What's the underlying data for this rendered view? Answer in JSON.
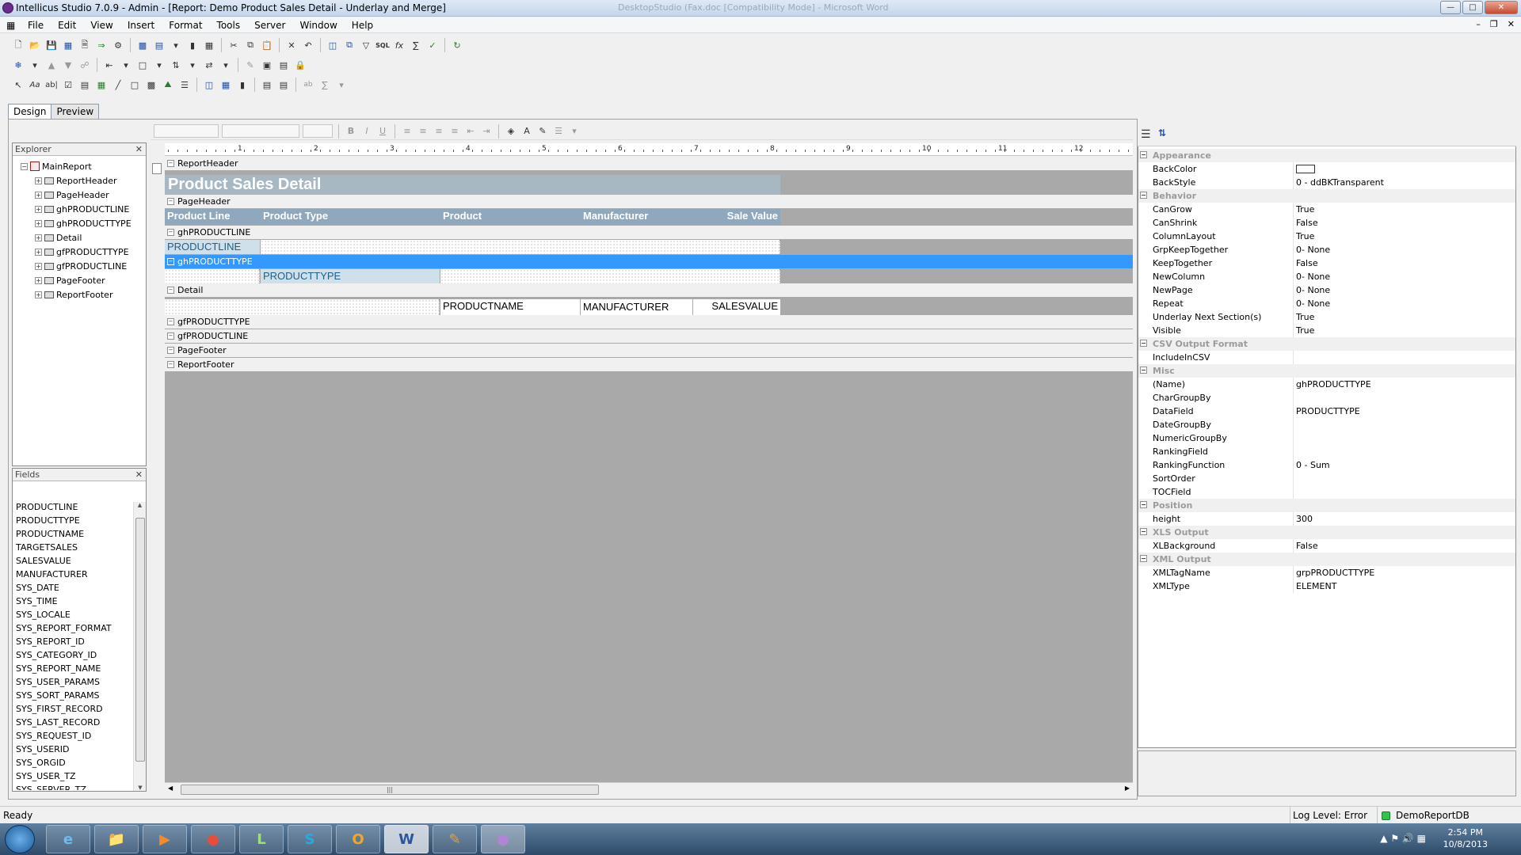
{
  "window": {
    "title": "Intellicus Studio 7.0.9 - Admin - [Report: Demo Product Sales Detail - Underlay and Merge]",
    "ghost_title": "DesktopStudio (Fax.doc [Compatibility Mode] - Microsoft Word"
  },
  "menu": [
    "File",
    "Edit",
    "View",
    "Insert",
    "Format",
    "Tools",
    "Server",
    "Window",
    "Help"
  ],
  "tabs": [
    "Design",
    "Preview"
  ],
  "explorer": {
    "title": "Explorer",
    "root": "MainReport",
    "items": [
      "ReportHeader",
      "PageHeader",
      "ghPRODUCTLINE",
      "ghPRODUCTTYPE",
      "Detail",
      "gfPRODUCTTYPE",
      "gfPRODUCTLINE",
      "PageFooter",
      "ReportFooter"
    ]
  },
  "fields": {
    "title": "Fields",
    "items": [
      "PRODUCTLINE",
      "PRODUCTTYPE",
      "PRODUCTNAME",
      "TARGETSALES",
      "SALESVALUE",
      "MANUFACTURER",
      "SYS_DATE",
      "SYS_TIME",
      "SYS_LOCALE",
      "SYS_REPORT_FORMAT",
      "SYS_REPORT_ID",
      "SYS_CATEGORY_ID",
      "SYS_REPORT_NAME",
      "SYS_USER_PARAMS",
      "SYS_SORT_PARAMS",
      "SYS_FIRST_RECORD",
      "SYS_LAST_RECORD",
      "SYS_REQUEST_ID",
      "SYS_USERID",
      "SYS_ORGID",
      "SYS_USER_TZ",
      "SYS_SERVER_TZ"
    ]
  },
  "design": {
    "bands": {
      "report_header": "ReportHeader",
      "page_header": "PageHeader",
      "gh_productline": "ghPRODUCTLINE",
      "gh_producttype": "ghPRODUCTTYPE",
      "detail": "Detail",
      "gf_producttype": "gfPRODUCTTYPE",
      "gf_productline": "gfPRODUCTLINE",
      "page_footer": "PageFooter",
      "report_footer": "ReportFooter"
    },
    "report_title": "Product Sales Detail",
    "columns": [
      "Product Line",
      "Product Type",
      "Product",
      "Manufacturer",
      "Sale Value"
    ],
    "productline_field": "PRODUCTLINE",
    "producttype_field": "PRODUCTTYPE",
    "detail_fields": [
      "PRODUCTNAME",
      "MANUFACTURER",
      "SALESVALUE"
    ],
    "ruler_numbers": [
      "1",
      "2",
      "3",
      "4",
      "5",
      "6",
      "7",
      "8",
      "9",
      "10",
      "11",
      "12"
    ],
    "colors": {
      "title_band": "#a8b8c3",
      "header_band": "#8fa8bd",
      "field_bg": "#cfe0ea",
      "selected": "#3399ff"
    }
  },
  "properties": {
    "categories": [
      {
        "name": "Appearance",
        "rows": [
          [
            "BackColor",
            ""
          ],
          [
            "BackStyle",
            "0 - ddBKTransparent"
          ]
        ]
      },
      {
        "name": "Behavior",
        "rows": [
          [
            "CanGrow",
            "True"
          ],
          [
            "CanShrink",
            "False"
          ],
          [
            "ColumnLayout",
            "True"
          ],
          [
            "GrpKeepTogether",
            "0- None"
          ],
          [
            "KeepTogether",
            "False"
          ],
          [
            "NewColumn",
            "0- None"
          ],
          [
            "NewPage",
            "0- None"
          ],
          [
            "Repeat",
            "0- None"
          ],
          [
            "Underlay Next Section(s)",
            "True"
          ],
          [
            "Visible",
            "True"
          ]
        ]
      },
      {
        "name": "CSV Output Format",
        "rows": [
          [
            "IncludeInCSV",
            ""
          ]
        ]
      },
      {
        "name": "Misc",
        "rows": [
          [
            "(Name)",
            "ghPRODUCTTYPE"
          ],
          [
            "CharGroupBy",
            ""
          ],
          [
            "DataField",
            "PRODUCTTYPE"
          ],
          [
            "DateGroupBy",
            ""
          ],
          [
            "NumericGroupBy",
            ""
          ],
          [
            "RankingField",
            ""
          ],
          [
            "RankingFunction",
            "0 - Sum"
          ],
          [
            "SortOrder",
            ""
          ],
          [
            "TOCField",
            ""
          ]
        ]
      },
      {
        "name": "Position",
        "rows": [
          [
            "height",
            "300"
          ]
        ]
      },
      {
        "name": "XLS Output",
        "rows": [
          [
            "XLBackground",
            "False"
          ]
        ]
      },
      {
        "name": "XML Output",
        "rows": [
          [
            "XMLTagName",
            "grpPRODUCTTYPE"
          ],
          [
            "XMLType",
            "ELEMENT"
          ]
        ]
      }
    ]
  },
  "status": {
    "left": "Ready",
    "log_level": "Log Level: Error",
    "db": "DemoReportDB"
  },
  "taskbar": {
    "time": "2:54 PM",
    "date": "10/8/2013"
  }
}
